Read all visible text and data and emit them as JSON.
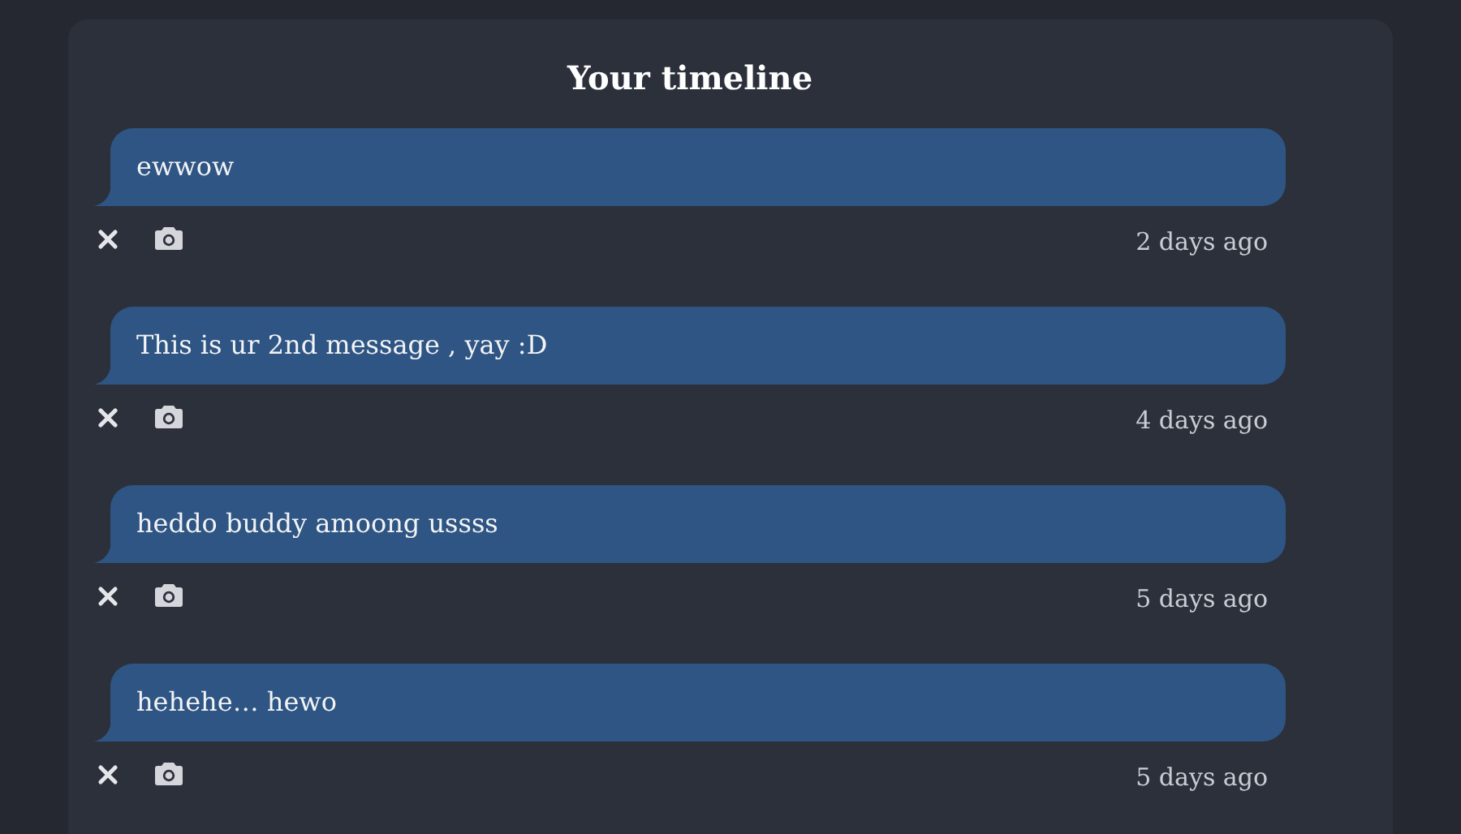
{
  "title": "Your timeline",
  "messages": [
    {
      "text": "ewwow",
      "time": "2 days ago"
    },
    {
      "text": "This is ur 2nd message , yay :D",
      "time": "4 days ago"
    },
    {
      "text": "heddo buddy amoong ussss",
      "time": "5 days ago"
    },
    {
      "text": "hehehe… hewo",
      "time": "5 days ago"
    }
  ]
}
